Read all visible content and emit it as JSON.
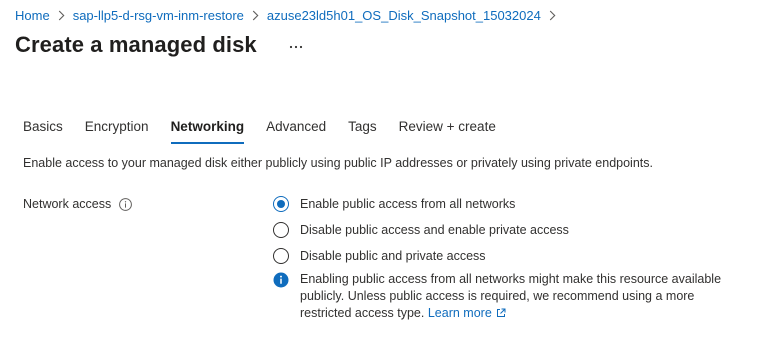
{
  "breadcrumb": {
    "items": [
      "Home",
      "sap-llp5-d-rsg-vm-inm-restore",
      "azuse23ld5h01_OS_Disk_Snapshot_15032024"
    ]
  },
  "page": {
    "title": "Create a managed disk",
    "more_icon": "ellipsis-icon"
  },
  "tabs": [
    {
      "label": "Basics",
      "active": false
    },
    {
      "label": "Encryption",
      "active": false
    },
    {
      "label": "Networking",
      "active": true
    },
    {
      "label": "Advanced",
      "active": false
    },
    {
      "label": "Tags",
      "active": false
    },
    {
      "label": "Review + create",
      "active": false
    }
  ],
  "networking": {
    "description": "Enable access to your managed disk either publicly using public IP addresses or privately using private endpoints.",
    "network_access_label": "Network access",
    "options": [
      {
        "label": "Enable public access from all networks",
        "selected": true
      },
      {
        "label": "Disable public access and enable private access",
        "selected": false
      },
      {
        "label": "Disable public and private access",
        "selected": false
      }
    ],
    "note_text": "Enabling public access from all networks might make this resource available publicly. Unless public access is required, we recommend using a more restricted access type.",
    "learn_more": "Learn more"
  },
  "colors": {
    "accent": "#0f6cbd",
    "text": "#323130"
  }
}
